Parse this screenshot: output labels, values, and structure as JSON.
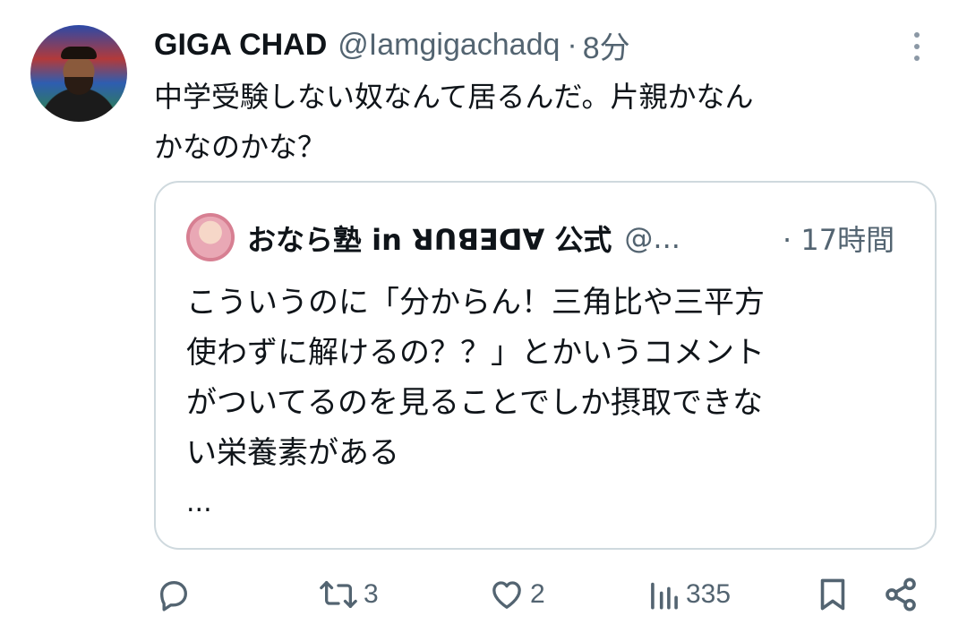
{
  "tweet": {
    "author_name": "GIGA CHAD",
    "author_handle": "@Iamgigachadq",
    "separator": "·",
    "time": "8分",
    "text_line1": "中学受験しない奴なんて居るんだ。片親かなん",
    "text_line2": "かなのかな？"
  },
  "quote": {
    "author_name": "おなら塾 in ꓤꓵꓭꓱꓷꓯ 公式",
    "author_handle": "@...",
    "time": "· 17時間",
    "lines": [
      "こういうのに「分からん！三角比や三平方",
      "使わずに解けるの？？」とかいうコメント",
      "がついてるのを見ることでしか摂取できな",
      "い栄養素がある"
    ],
    "ellipsis": "..."
  },
  "actions": {
    "reply_count": "",
    "retweet_count": "3",
    "like_count": "2",
    "views_count": "335"
  },
  "icons": {
    "reply": "reply-icon",
    "retweet": "retweet-icon",
    "like": "heart-icon",
    "views": "views-icon",
    "bookmark": "bookmark-icon",
    "share": "share-icon",
    "more": "more-icon"
  }
}
